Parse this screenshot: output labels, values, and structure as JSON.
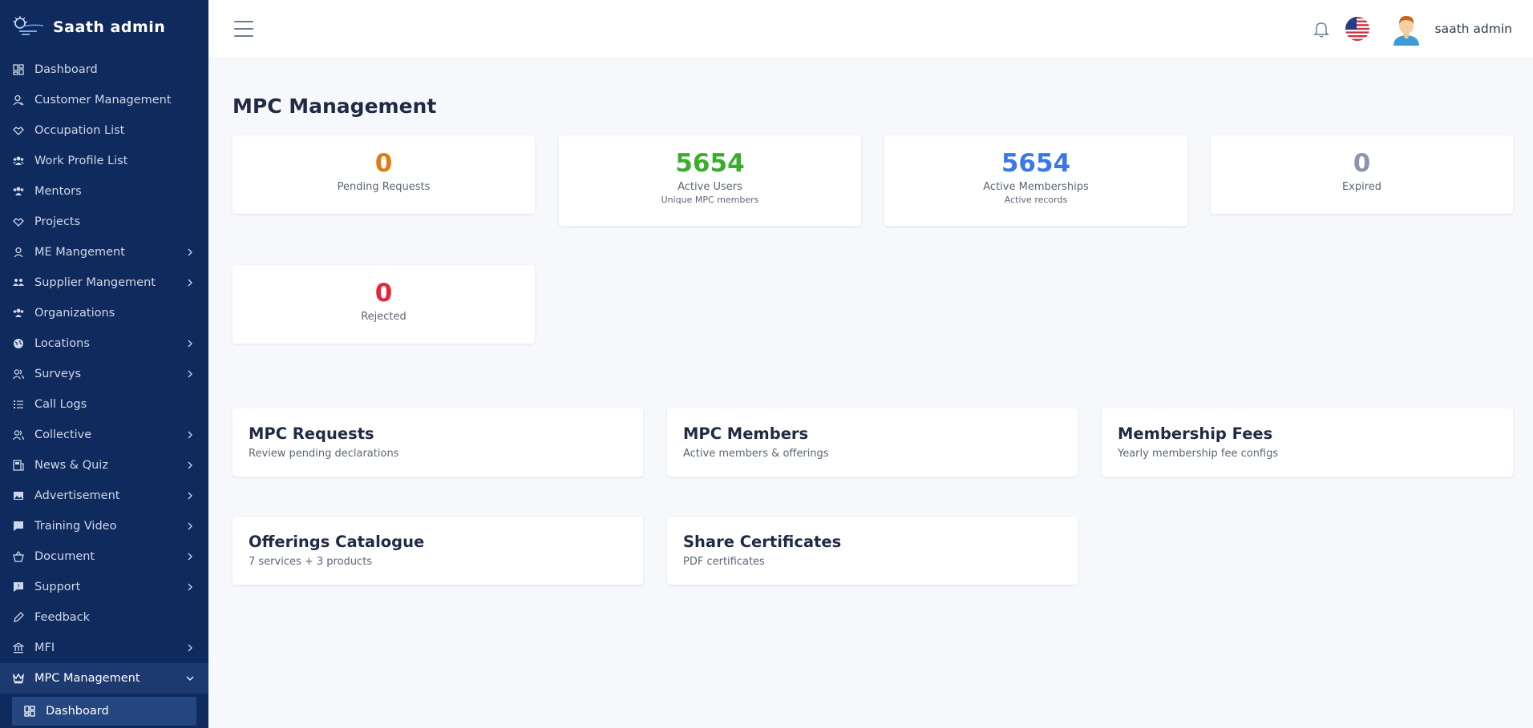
{
  "app": {
    "title": "Saath admin"
  },
  "sidebar": {
    "items": [
      {
        "label": "Dashboard",
        "icon": "dashboard-icon",
        "expandable": false
      },
      {
        "label": "Customer Management",
        "icon": "user-icon",
        "expandable": false
      },
      {
        "label": "Occupation List",
        "icon": "handshake-icon",
        "expandable": false
      },
      {
        "label": "Work Profile List",
        "icon": "users-icon",
        "expandable": false
      },
      {
        "label": "Mentors",
        "icon": "users-icon",
        "expandable": false
      },
      {
        "label": "Projects",
        "icon": "handshake-icon",
        "expandable": false
      },
      {
        "label": "ME Mangement",
        "icon": "user-icon",
        "expandable": true
      },
      {
        "label": "Supplier Mangement",
        "icon": "people-icon",
        "expandable": true
      },
      {
        "label": "Organizations",
        "icon": "users-icon",
        "expandable": false
      },
      {
        "label": "Locations",
        "icon": "globe-icon",
        "expandable": true
      },
      {
        "label": "Surveys",
        "icon": "user-group-icon",
        "expandable": true
      },
      {
        "label": "Call Logs",
        "icon": "list-icon",
        "expandable": false
      },
      {
        "label": "Collective",
        "icon": "user-group-icon",
        "expandable": true
      },
      {
        "label": "News & Quiz",
        "icon": "newspaper-icon",
        "expandable": true
      },
      {
        "label": "Advertisement",
        "icon": "image-icon",
        "expandable": true
      },
      {
        "label": "Training Video",
        "icon": "chat-icon",
        "expandable": true
      },
      {
        "label": "Document",
        "icon": "basket-icon",
        "expandable": true
      },
      {
        "label": "Support",
        "icon": "help-icon",
        "expandable": true
      },
      {
        "label": "Feedback",
        "icon": "pencil-icon",
        "expandable": false
      },
      {
        "label": "MFI",
        "icon": "bank-icon",
        "expandable": true
      },
      {
        "label": "MPC Management",
        "icon": "crown-icon",
        "expandable": true,
        "active": true
      }
    ],
    "sub_item": {
      "label": "Dashboard",
      "icon": "dashboard-icon"
    }
  },
  "topbar": {
    "username": "saath admin"
  },
  "page": {
    "title": "MPC Management"
  },
  "stats": [
    {
      "value": "0",
      "label": "Pending Requests",
      "sub": "",
      "color": "#e07b12"
    },
    {
      "value": "5654",
      "label": "Active Users",
      "sub": "Unique MPC members",
      "color": "#3aad2c"
    },
    {
      "value": "5654",
      "label": "Active Memberships",
      "sub": "Active records",
      "color": "#3b78e7"
    },
    {
      "value": "0",
      "label": "Expired",
      "sub": "",
      "color": "#8a95a8"
    },
    {
      "value": "0",
      "label": "Rejected",
      "sub": "",
      "color": "#e8243a"
    }
  ],
  "cards": [
    {
      "title": "MPC Requests",
      "desc": "Review pending declarations"
    },
    {
      "title": "MPC Members",
      "desc": "Active members & offerings"
    },
    {
      "title": "Membership Fees",
      "desc": "Yearly membership fee configs"
    },
    {
      "title": "Offerings Catalogue",
      "desc": "7 services + 3 products"
    },
    {
      "title": "Share Certificates",
      "desc": "PDF certificates"
    }
  ]
}
